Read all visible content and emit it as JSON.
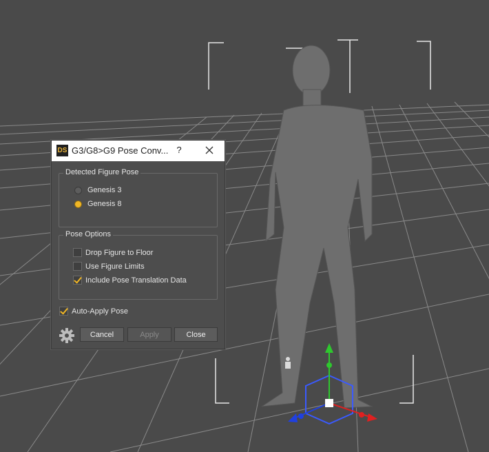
{
  "viewport": {
    "background": "#4a4a4a",
    "grid_color": "#8c8c8c",
    "figure_color": "#6e6e6e"
  },
  "dialog": {
    "app_icon_text": "DS",
    "title": "G3/G8>G9 Pose Conv...",
    "help_label": "?",
    "detected_group": {
      "label": "Detected Figure Pose",
      "options": [
        {
          "label": "Genesis 3",
          "selected": false
        },
        {
          "label": "Genesis 8",
          "selected": true
        }
      ]
    },
    "options_group": {
      "label": "Pose Options",
      "items": [
        {
          "label": "Drop Figure to Floor",
          "checked": false
        },
        {
          "label": "Use Figure Limits",
          "checked": false
        },
        {
          "label": "Include Pose Translation Data",
          "checked": true
        }
      ]
    },
    "auto_apply": {
      "label": "Auto-Apply Pose",
      "checked": true
    },
    "buttons": {
      "cancel": "Cancel",
      "apply": "Apply",
      "close": "Close"
    },
    "accent_color": "#f0b625"
  }
}
